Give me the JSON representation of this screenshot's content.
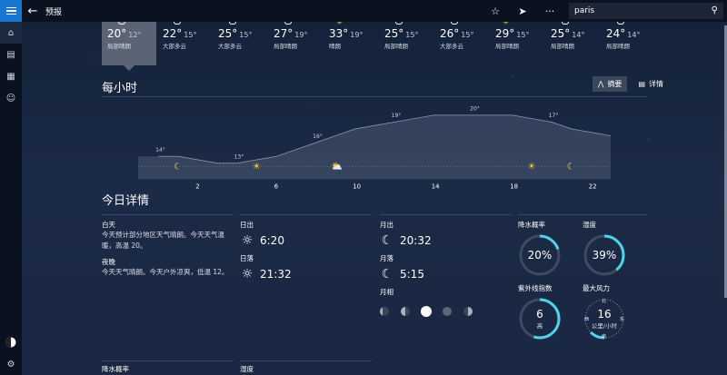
{
  "titlebar": {
    "title": "预报",
    "search_value": "paris"
  },
  "daily": [
    {
      "hi": "20°",
      "lo": "12°",
      "cond": "局部晴朗",
      "icon": "moon-icon",
      "selected": true
    },
    {
      "hi": "22°",
      "lo": "15°",
      "cond": "大部多云",
      "icon": "cloud-icon",
      "selected": false
    },
    {
      "hi": "25°",
      "lo": "15°",
      "cond": "大部多云",
      "icon": "cloud-icon",
      "selected": false
    },
    {
      "hi": "27°",
      "lo": "19°",
      "cond": "局部晴朗",
      "icon": "cloud-icon",
      "selected": false
    },
    {
      "hi": "33°",
      "lo": "19°",
      "cond": "晴朗",
      "icon": "sun-icon",
      "selected": false
    },
    {
      "hi": "25°",
      "lo": "15°",
      "cond": "局部晴朗",
      "icon": "cloud-icon",
      "selected": false
    },
    {
      "hi": "26°",
      "lo": "15°",
      "cond": "大部多云",
      "icon": "cloud-icon",
      "selected": false
    },
    {
      "hi": "29°",
      "lo": "15°",
      "cond": "局部晴朗",
      "icon": "sun-icon",
      "selected": false
    },
    {
      "hi": "25°",
      "lo": "14°",
      "cond": "局部晴朗",
      "icon": "cloud-icon",
      "selected": false
    },
    {
      "hi": "24°",
      "lo": "14°",
      "cond": "局部晴朗",
      "icon": "cloud-icon",
      "selected": false
    }
  ],
  "hourly": {
    "title": "每小时",
    "summary_label": "摘要",
    "details_label": "详情",
    "x_ticks": [
      "2",
      "6",
      "10",
      "14",
      "18",
      "22"
    ],
    "temp_labels": [
      {
        "hour": 0,
        "text": "14°"
      },
      {
        "hour": 4,
        "text": "13°"
      },
      {
        "hour": 8,
        "text": "16°"
      },
      {
        "hour": 12,
        "text": "19°"
      },
      {
        "hour": 16,
        "text": "20°"
      },
      {
        "hour": 20,
        "text": "17°"
      }
    ],
    "temps": [
      14,
      14,
      13.5,
      13,
      13,
      13.5,
      14,
      15,
      16,
      17,
      18,
      18.5,
      19,
      19.5,
      20,
      20,
      20,
      20,
      20,
      19.5,
      19,
      18,
      17.5,
      17
    ],
    "icons": [
      {
        "hour": 1,
        "icon": "moon-icon"
      },
      {
        "hour": 5,
        "icon": "sun-icon"
      },
      {
        "hour": 9,
        "icon": "partly-cloudy-icon"
      },
      {
        "hour": 19,
        "icon": "sun-icon"
      },
      {
        "hour": 21,
        "icon": "moon-icon"
      }
    ]
  },
  "details": {
    "title": "今日详情",
    "day_label": "白天",
    "day_text": "今天预计部分地区天气晴朗。今天天气温暖，高温 20。",
    "night_label": "夜晚",
    "night_text": "今天天气晴朗。今天户外凉爽，低温 12。",
    "sunrise_label": "日出",
    "sunrise": "6:20",
    "sunset_label": "日落",
    "sunset": "21:32",
    "moonrise_label": "月出",
    "moonrise": "20:32",
    "moonset_label": "月落",
    "moonset": "5:15",
    "moonphase_label": "月相",
    "precip_label": "降水概率",
    "precip": "20%",
    "precip_fraction": 0.2,
    "humidity_label": "湿度",
    "humidity": "39%",
    "humidity_fraction": 0.39,
    "uv_label": "紫外线指数",
    "uv": "6",
    "uv_level": "高",
    "uv_fraction": 0.55,
    "wind_label": "最大风力",
    "wind": "16",
    "wind_unit": "公里/小时",
    "compass_n": "北",
    "compass_s": "南",
    "compass_e": "东",
    "compass_w": "西"
  },
  "bottom": {
    "precip_label": "降水概率",
    "humidity_label": "湿度"
  },
  "colors": {
    "accent": "#1976d2",
    "gauge": "#4fd3ea",
    "sun": "#f3c83d",
    "moon": "#f0d25a"
  }
}
